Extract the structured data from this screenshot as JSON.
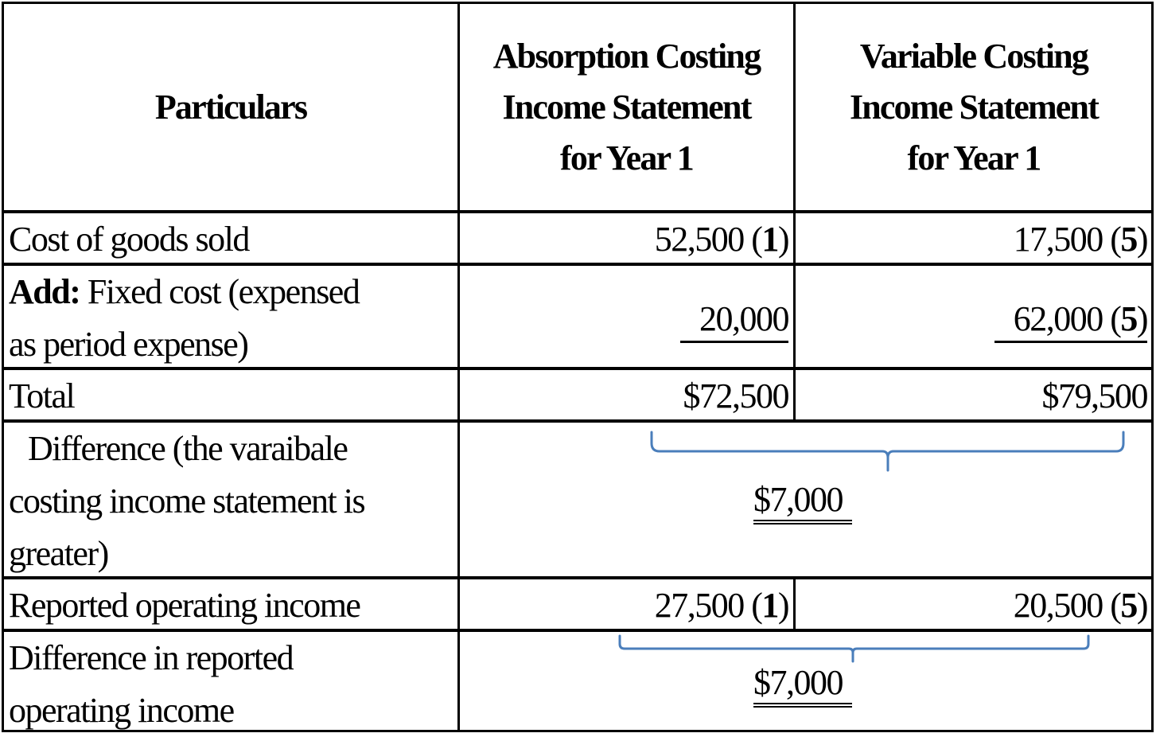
{
  "table": {
    "headers": {
      "particulars": "Particulars",
      "absorption": [
        "Absorption Costing",
        "Income Statement",
        "for Year 1"
      ],
      "variable": [
        "Variable Costing",
        "Income Statement",
        "for Year 1"
      ]
    },
    "rows": {
      "cogs": {
        "label": "Cost of goods sold",
        "absorption_value": "52,500",
        "absorption_ref": "1",
        "variable_value": "17,500",
        "variable_ref": "5"
      },
      "fixed": {
        "label_bold": "Add:",
        "label_rest": " Fixed cost (expensed",
        "label_line2": "as period expense)",
        "absorption_value": "20,000",
        "variable_value": "62,000",
        "variable_ref": "5"
      },
      "total": {
        "label": "Total",
        "absorption_value": "$72,500",
        "variable_value": "$79,500"
      },
      "difference": {
        "label": [
          "Difference (the varaibale",
          "costing income statement is",
          "greater)"
        ],
        "value": "$7,000"
      },
      "operating_income": {
        "label": "Reported operating income",
        "absorption_value": "27,500",
        "absorption_ref": "1",
        "variable_value": "20,500",
        "variable_ref": "5"
      },
      "operating_difference": {
        "label": [
          "Difference in reported",
          "operating income"
        ],
        "value": "$7,000"
      }
    }
  },
  "colors": {
    "border": "#000000",
    "bracket": "#4a7ebb"
  }
}
